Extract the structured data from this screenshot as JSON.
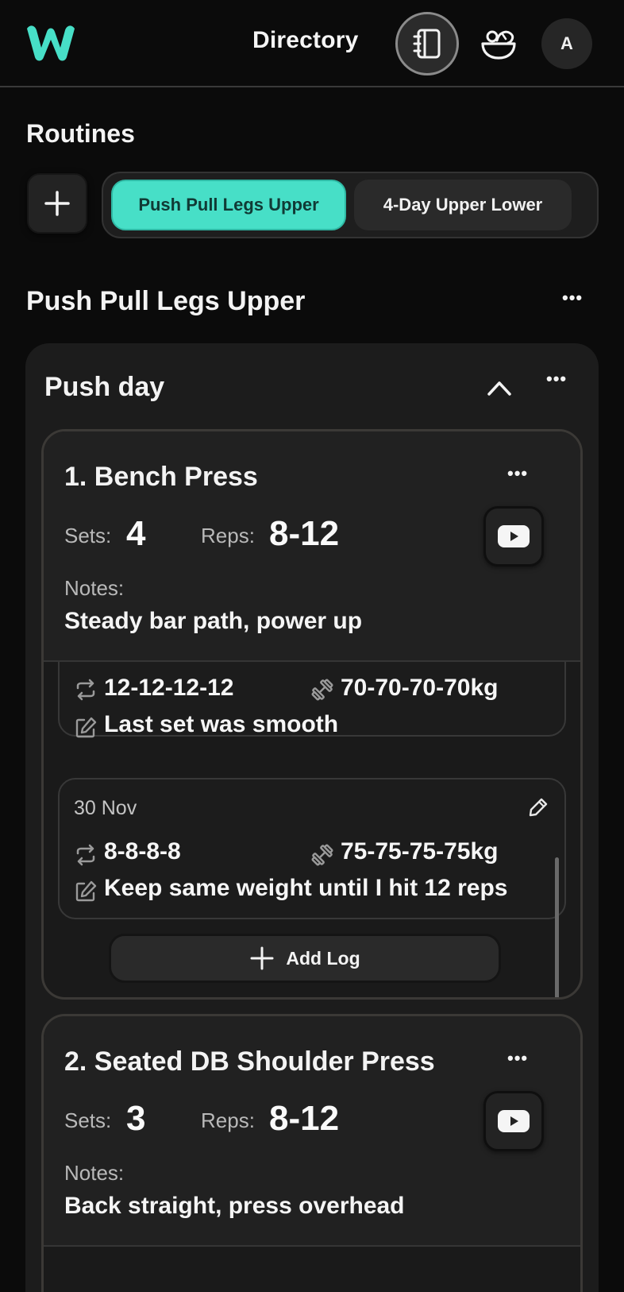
{
  "header": {
    "nav_directory": "Directory",
    "avatar_initial": "A",
    "icons": [
      "logo-icon",
      "notebook-icon",
      "bowl-icon"
    ]
  },
  "routines": {
    "section_title": "Routines",
    "tabs": [
      {
        "label": "Push Pull Legs Upper",
        "active": true
      },
      {
        "label": "4-Day Upper Lower",
        "active": false
      }
    ],
    "selected_title": "Push Pull Legs Upper"
  },
  "day": {
    "title": "Push day",
    "exercises": [
      {
        "name": "1. Bench Press",
        "sets_label": "Sets:",
        "sets": "4",
        "reps_label": "Reps:",
        "reps": "8-12",
        "notes_label": "Notes:",
        "notes": "Steady bar path, power up",
        "logs": [
          {
            "date": "",
            "reps": "12-12-12-12",
            "weight": "70-70-70-70kg",
            "note": "Last set was smooth"
          },
          {
            "date": "30 Nov",
            "reps": "8-8-8-8",
            "weight": "75-75-75-75kg",
            "note": "Keep same weight until I hit 12 reps"
          }
        ],
        "add_log_label": "Add Log"
      },
      {
        "name": "2. Seated DB Shoulder Press",
        "sets_label": "Sets:",
        "sets": "3",
        "reps_label": "Reps:",
        "reps": "8-12",
        "notes_label": "Notes:",
        "notes": "Back straight, press overhead"
      }
    ]
  },
  "colors": {
    "accent": "#47dfc7",
    "background": "#0b0b0b",
    "card": "#1c1c1c"
  }
}
